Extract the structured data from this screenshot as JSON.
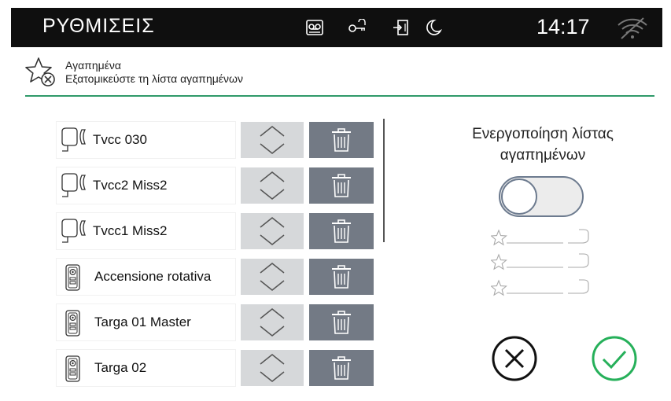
{
  "statusbar": {
    "title": "ΡΥΘΜΙΣΕΙΣ",
    "time": "14:17",
    "icons": [
      "voicemail-icon",
      "door-key-icon",
      "exit-door-icon",
      "do-not-disturb-moon-icon",
      "wifi-off-icon"
    ]
  },
  "header": {
    "icon": "favorites-star-icon",
    "title": "Αγαπημένα",
    "subtitle": "Εξατομικεύστε τη λίστα αγαπημένων"
  },
  "list": {
    "items": [
      {
        "label": "Tvcc 030",
        "icon": "cctv-camera-icon"
      },
      {
        "label": "Tvcc2 Miss2",
        "icon": "cctv-camera-icon"
      },
      {
        "label": "Tvcc1 Miss2",
        "icon": "cctv-camera-icon"
      },
      {
        "label": "Accensione rotativa",
        "icon": "entry-panel-icon"
      },
      {
        "label": "Targa 01 Master",
        "icon": "entry-panel-icon"
      },
      {
        "label": "Targa 02",
        "icon": "entry-panel-icon"
      }
    ]
  },
  "panel": {
    "enable_line1": "Ενεργοποίηση λίστας",
    "enable_line2": "αγαπημένων",
    "toggle_on": false
  },
  "colors": {
    "accent_green": "#2f9a6a",
    "delete_bg": "#737a85",
    "arrows_bg": "#d6d8da",
    "confirm": "#26b05a"
  }
}
